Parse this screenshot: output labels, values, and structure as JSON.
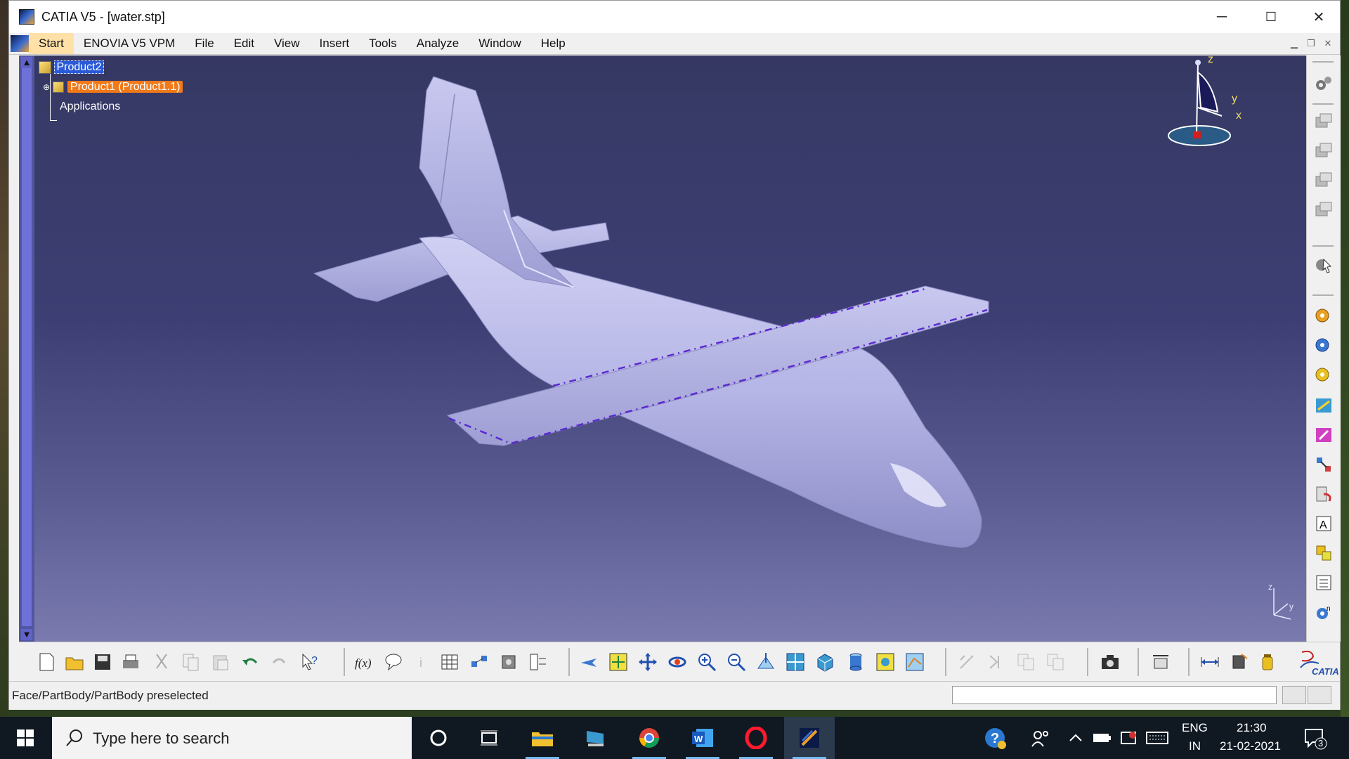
{
  "window": {
    "title": "CATIA V5 - [water.stp]",
    "minimize_symbol": "─",
    "maximize_symbol": "☐",
    "close_symbol": "✕"
  },
  "menu": {
    "items": [
      "Start",
      "ENOVIA V5 VPM",
      "File",
      "Edit",
      "View",
      "Insert",
      "Tools",
      "Analyze",
      "Window",
      "Help"
    ]
  },
  "tree": {
    "root": "Product2",
    "child": "Product1 (Product1.1)",
    "applications": "Applications"
  },
  "compass": {
    "z": "z",
    "y": "y",
    "x": "x"
  },
  "axis_mini": {
    "z": "z",
    "y": "y"
  },
  "status": {
    "message": "Face/PartBody/PartBody preselected",
    "command_input": ""
  },
  "taskbar": {
    "search_placeholder": "Type here to search",
    "language": "ENG",
    "region": "IN",
    "time": "21:30",
    "date": "21-02-2021",
    "notification_count": "3"
  },
  "brand": {
    "catia_logo_text": "CATIA"
  },
  "colors": {
    "viewport_top": "#363863",
    "viewport_bottom": "#7a7aaf",
    "model_fill": "#b5b5e6",
    "selection_orange": "#f07a1a",
    "selection_blue": "#2a5ad8"
  }
}
